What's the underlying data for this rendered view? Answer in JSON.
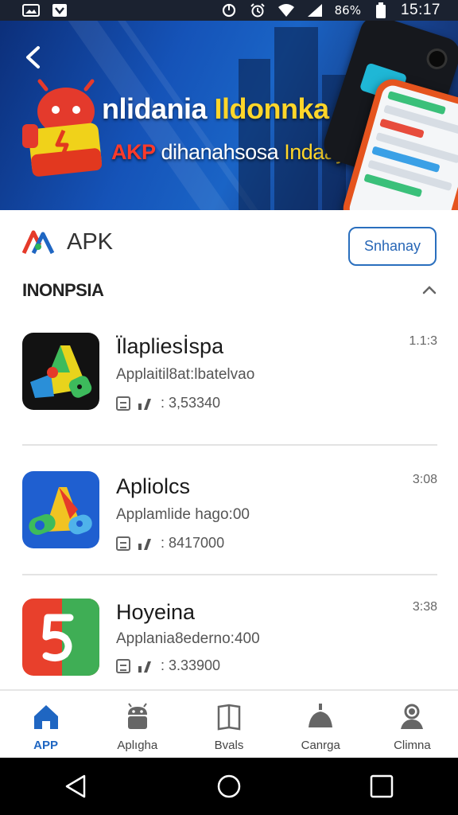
{
  "status_bar": {
    "battery_text": "86%",
    "time": "15:17"
  },
  "banner": {
    "title_part1": "nlidania",
    "title_part2": "Ildonnka",
    "subtitle_part1": "AKP",
    "subtitle_part2": "dihanahsosa",
    "subtitle_part3": "Indaay"
  },
  "header": {
    "title": "APK",
    "button_label": "Snhanay"
  },
  "section": {
    "title": "INONPSIA"
  },
  "apps": [
    {
      "name": "Ïlapliesİspa",
      "description": "Applaitil8at:lbatelvao",
      "size": ": 3,53340",
      "time": "1.1:3"
    },
    {
      "name": "Apliolcs",
      "description": "Applamlide hago:00",
      "size": ": 8417000",
      "time": "3:08"
    },
    {
      "name": "Hoyeina",
      "description": "Applania8ederno:400",
      "size": ": 3.33900",
      "time": "3:38"
    }
  ],
  "bottom_nav": [
    {
      "label": "APP",
      "active": true
    },
    {
      "label": "Aplıgha",
      "active": false
    },
    {
      "label": "Bvals",
      "active": false
    },
    {
      "label": "Canrga",
      "active": false
    },
    {
      "label": "Climna",
      "active": false
    }
  ],
  "colors": {
    "accent": "#1f66c2",
    "banner": "#1553b8",
    "status_bar": "#1b2230"
  }
}
